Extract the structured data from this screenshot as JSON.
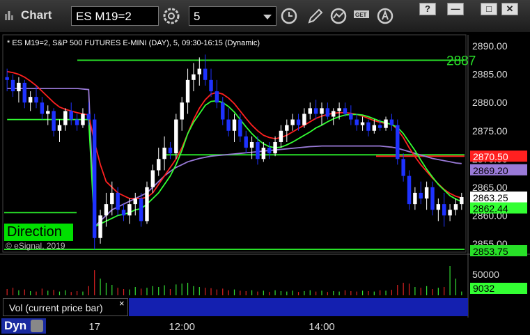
{
  "window": {
    "title": "Chart",
    "symbol": "ES M19=2",
    "interval": "5",
    "controls": [
      "?",
      "—",
      "□",
      "✕"
    ],
    "toolbar_icons": [
      "gear-icon",
      "clock-icon",
      "pencil-icon",
      "study-icon",
      "get-icon",
      "alert-icon"
    ]
  },
  "chart_header": "* ES M19=2, S&P 500 FUTURES E-MINI (DAY), 5, 09:30-16:15 (Dynamic)",
  "direction_label": "Direction",
  "copyright": "© eSignal, 2019",
  "volume_panel": {
    "label": "Vol (current price bar)",
    "close_symbol": "×",
    "tick_labels": [
      "50000"
    ],
    "current_badge": "9032"
  },
  "bottom_bar": {
    "button": "Dyn",
    "time_labels": [
      "17",
      "12:00",
      "14:00"
    ]
  },
  "colors": {
    "up": "#ffffff",
    "down": "#1e32ff",
    "ma_red": "#ff2020",
    "ma_green": "#33ff33",
    "ma_purple": "#9a7ad8",
    "level_green": "#28e028",
    "level_red": "#ff2020",
    "grid": "#333333"
  },
  "chart_data": {
    "type": "candlestick",
    "title": "ES M19=2, S&P 500 FUTURES E-MINI (DAY)",
    "ylim": [
      2853.5,
      2892
    ],
    "y_ticks": [
      2890.0,
      2885.0,
      2880.0,
      2875.0,
      2870.0,
      2865.0,
      2860.0,
      2855.0
    ],
    "price_badges": [
      {
        "value": "2870.50",
        "bg": "#ff2020",
        "fg": "#ffffff"
      },
      {
        "value": "2869.20",
        "bg": "#9a7ad8",
        "fg": "#000000"
      },
      {
        "value": "2863.25",
        "bg": "#ffffff",
        "fg": "#000000"
      },
      {
        "value": "2862.44",
        "bg": "#33ff33",
        "fg": "#000000"
      },
      {
        "value": "2853.75",
        "bg": "#28e028",
        "fg": "#000000"
      }
    ],
    "levels": [
      {
        "name": "level-top",
        "value": 2887.5,
        "color": "#28e028",
        "label": "2887"
      },
      {
        "name": "level-mid",
        "value": 2870.75,
        "color": "#28e028"
      },
      {
        "name": "level-red",
        "value": 2870.5,
        "color": "#ff2020"
      },
      {
        "name": "level-left",
        "value": 2860.5,
        "color": "#28e028"
      },
      {
        "name": "level-bottom",
        "value": 2854.0,
        "color": "#28e028"
      }
    ],
    "candles": [
      [
        2884.5,
        2886,
        2882,
        2884
      ],
      [
        2884,
        2885,
        2881,
        2882
      ],
      [
        2882,
        2884.5,
        2880,
        2883.5
      ],
      [
        2883.5,
        2884,
        2879,
        2880
      ],
      [
        2880,
        2882,
        2878.5,
        2881
      ],
      [
        2881,
        2883,
        2879,
        2880
      ],
      [
        2880,
        2881,
        2877,
        2878
      ],
      [
        2878,
        2879.5,
        2876,
        2878.5
      ],
      [
        2878.5,
        2879,
        2874,
        2875
      ],
      [
        2875,
        2877,
        2873,
        2876
      ],
      [
        2876,
        2879,
        2875,
        2878.5
      ],
      [
        2878.5,
        2880,
        2876,
        2877
      ],
      [
        2877,
        2878,
        2875,
        2876
      ],
      [
        2876,
        2879,
        2875.5,
        2878
      ],
      [
        2878,
        2880,
        2876,
        2877
      ],
      [
        2877,
        2878,
        2854,
        2856
      ],
      [
        2856,
        2861,
        2855,
        2860
      ],
      [
        2860,
        2864,
        2858,
        2862
      ],
      [
        2862,
        2866,
        2860,
        2864
      ],
      [
        2864,
        2865,
        2860,
        2861
      ],
      [
        2861,
        2862,
        2859,
        2860
      ],
      [
        2860,
        2863,
        2858.5,
        2862
      ],
      [
        2862,
        2864,
        2860,
        2863
      ],
      [
        2863,
        2864,
        2858,
        2859
      ],
      [
        2859,
        2866,
        2858.5,
        2865
      ],
      [
        2865,
        2869,
        2864,
        2868
      ],
      [
        2868,
        2872,
        2867,
        2870
      ],
      [
        2870,
        2874,
        2868,
        2872
      ],
      [
        2872,
        2873,
        2870,
        2871
      ],
      [
        2871,
        2878,
        2870,
        2877
      ],
      [
        2877,
        2881,
        2875,
        2880
      ],
      [
        2880,
        2886,
        2878,
        2884
      ],
      [
        2884,
        2887,
        2882,
        2885
      ],
      [
        2885,
        2888,
        2883,
        2886
      ],
      [
        2886,
        2888.5,
        2883,
        2884
      ],
      [
        2884,
        2886,
        2881,
        2882
      ],
      [
        2882,
        2884,
        2879,
        2880
      ],
      [
        2880,
        2881,
        2876,
        2877
      ],
      [
        2877,
        2879,
        2874,
        2875
      ],
      [
        2875,
        2878,
        2873,
        2877
      ],
      [
        2877,
        2878,
        2873,
        2874
      ],
      [
        2874,
        2875,
        2871,
        2872
      ],
      [
        2872,
        2874,
        2870,
        2873
      ],
      [
        2873,
        2874,
        2869,
        2870
      ],
      [
        2870,
        2873,
        2869.5,
        2872
      ],
      [
        2872,
        2873,
        2870,
        2871
      ],
      [
        2871,
        2874,
        2870.5,
        2873
      ],
      [
        2873,
        2876,
        2872,
        2875
      ],
      [
        2875,
        2877,
        2873,
        2876
      ],
      [
        2876,
        2878,
        2875,
        2877
      ],
      [
        2877,
        2878,
        2875,
        2876
      ],
      [
        2876,
        2879,
        2875.5,
        2878
      ],
      [
        2878,
        2880,
        2877,
        2879
      ],
      [
        2879,
        2880.5,
        2877,
        2878
      ],
      [
        2878,
        2880,
        2876,
        2879
      ],
      [
        2879,
        2880,
        2877,
        2877.5
      ],
      [
        2877.5,
        2879,
        2876,
        2878.5
      ],
      [
        2878.5,
        2880,
        2877,
        2879
      ],
      [
        2879,
        2880,
        2877.5,
        2878
      ],
      [
        2878,
        2879.5,
        2876,
        2877
      ],
      [
        2877,
        2878,
        2875,
        2876
      ],
      [
        2876,
        2877.5,
        2875,
        2876.5
      ],
      [
        2876.5,
        2877,
        2874,
        2875
      ],
      [
        2875,
        2877,
        2874.5,
        2876
      ],
      [
        2876,
        2877,
        2875,
        2875.5
      ],
      [
        2875.5,
        2877.5,
        2875,
        2877
      ],
      [
        2877,
        2878,
        2875,
        2876
      ],
      [
        2876,
        2877,
        2869,
        2870
      ],
      [
        2870,
        2871,
        2866,
        2867
      ],
      [
        2867,
        2868,
        2861,
        2862
      ],
      [
        2862,
        2865,
        2861,
        2864
      ],
      [
        2864,
        2866,
        2862,
        2863
      ],
      [
        2863,
        2866,
        2861,
        2865
      ],
      [
        2865,
        2866,
        2860,
        2861
      ],
      [
        2861,
        2863,
        2859,
        2862
      ],
      [
        2862,
        2864,
        2858,
        2860
      ],
      [
        2860,
        2862,
        2859,
        2861
      ],
      [
        2861,
        2863,
        2860,
        2862
      ],
      [
        2862,
        2864,
        2861,
        2863.25
      ]
    ],
    "ma_red": [
      2885.5,
      2885.3,
      2885,
      2884.5,
      2883.8,
      2883,
      2882,
      2881,
      2880,
      2879.2,
      2878.8,
      2878.5,
      2878.2,
      2878,
      2877.8,
      2873,
      2869,
      2866,
      2865,
      2864,
      2863.5,
      2863,
      2863,
      2863,
      2863.2,
      2864,
      2865.5,
      2867,
      2868.5,
      2870,
      2872,
      2874.5,
      2877,
      2879,
      2880.5,
      2881.5,
      2881.8,
      2881.5,
      2880.8,
      2879.8,
      2878.5,
      2877.2,
      2876,
      2875,
      2874.2,
      2873.8,
      2873.6,
      2873.8,
      2874.2,
      2874.8,
      2875.4,
      2876,
      2876.6,
      2877.2,
      2877.6,
      2877.9,
      2878.1,
      2878.2,
      2878.2,
      2878.1,
      2877.9,
      2877.6,
      2877.2,
      2876.8,
      2876.5,
      2876.3,
      2876.2,
      2875.2,
      2873.8,
      2872,
      2870.4,
      2869,
      2867.8,
      2866.6,
      2865.6,
      2864.6,
      2863.9,
      2863.4,
      2863.1
    ],
    "ma_green": [
      2877,
      2877,
      2877,
      2877,
      2877,
      2877,
      2877,
      2877,
      2877,
      2877,
      2877,
      2877,
      2877,
      2877,
      2877,
      2858,
      2858.5,
      2859,
      2859.5,
      2860,
      2860.2,
      2860.5,
      2861,
      2861.2,
      2862,
      2863,
      2864,
      2865.5,
      2867,
      2869,
      2871.5,
      2874.5,
      2876.5,
      2878,
      2879.5,
      2880.2,
      2880.3,
      2880,
      2879.3,
      2878.3,
      2877,
      2875.7,
      2874.5,
      2873.5,
      2872.7,
      2872.2,
      2872,
      2872.1,
      2872.5,
      2873,
      2873.6,
      2874.2,
      2874.8,
      2875.5,
      2876,
      2876.6,
      2877.1,
      2877.5,
      2877.8,
      2877.9,
      2877.9,
      2877.8,
      2877.5,
      2877.1,
      2876.7,
      2876.4,
      2876.1,
      2875.6,
      2874.5,
      2873,
      2871.5,
      2869.8,
      2868.2,
      2866.8,
      2865.5,
      2864.5,
      2863.5,
      2862.9,
      2862.44
    ],
    "ma_purple": [
      2882.5,
      2882.5,
      2882.5,
      2882.5,
      2882.5,
      2882.5,
      2882.5,
      2882.5,
      2882.5,
      2882.5,
      2882.5,
      2882.5,
      2882.5,
      2882.4,
      2882.3,
      2858,
      2859,
      2860,
      2861,
      2861.5,
      2862,
      2862.5,
      2863,
      2863.5,
      2864,
      2865,
      2866,
      2867,
      2867.8,
      2868.5,
      2869,
      2869.5,
      2869.8,
      2870.1,
      2870.3,
      2870.5,
      2870.6,
      2870.7,
      2870.8,
      2870.9,
      2871,
      2871.1,
      2871.2,
      2871.3,
      2871.4,
      2871.5,
      2871.6,
      2871.7,
      2871.8,
      2871.9,
      2872,
      2872.1,
      2872.2,
      2872.25,
      2872.3,
      2872.3,
      2872.3,
      2872.3,
      2872.3,
      2872.3,
      2872.3,
      2872.3,
      2872.3,
      2872.3,
      2872.3,
      2872.2,
      2872.1,
      2871.9,
      2871.6,
      2871.3,
      2871,
      2870.7,
      2870.4,
      2870.1,
      2869.9,
      2869.7,
      2869.5,
      2869.3,
      2869.2
    ],
    "volume_ylim": [
      0,
      90000
    ],
    "volume": [
      15000,
      18000,
      12000,
      14000,
      10000,
      9000,
      16000,
      11000,
      13000,
      9000,
      12000,
      8000,
      10000,
      9000,
      22000,
      60000,
      40000,
      30000,
      25000,
      18000,
      15000,
      14000,
      20000,
      16000,
      18000,
      22000,
      20000,
      24000,
      15000,
      26000,
      28000,
      30000,
      22000,
      20000,
      18000,
      17000,
      14000,
      16000,
      12000,
      14000,
      11000,
      10000,
      12000,
      9000,
      11000,
      8000,
      12000,
      10000,
      9000,
      11000,
      8000,
      10000,
      12000,
      9000,
      11000,
      8000,
      10000,
      9000,
      12000,
      10000,
      9000,
      11000,
      10000,
      9000,
      12000,
      11000,
      13000,
      25000,
      30000,
      28000,
      20000,
      18000,
      22000,
      15000,
      18000,
      20000,
      70000,
      40000,
      9032
    ],
    "x_tick_labels": [
      {
        "label": "17",
        "index": 15
      },
      {
        "label": "12:00",
        "index": 30
      },
      {
        "label": "14:00",
        "index": 54
      }
    ]
  }
}
